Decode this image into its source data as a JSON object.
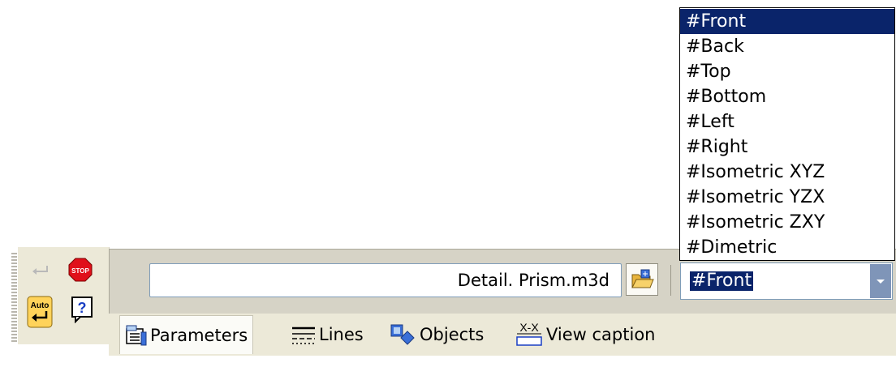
{
  "toolbar": {
    "filename": "Detail. Prism.m3d",
    "view_combo_value": "#Front",
    "buttons": {
      "enter_icon": "enter-arrow-icon",
      "stop_label": "STOP",
      "auto_label": "Auto",
      "help_label": "?"
    }
  },
  "view_dropdown": {
    "items": [
      "#Front",
      "#Back",
      "#Top",
      "#Bottom",
      "#Left",
      "#Right",
      "#Isometric XYZ",
      "#Isometric YZX",
      "#Isometric ZXY",
      "#Dimetric"
    ],
    "selected": "#Front"
  },
  "tabs": {
    "parameters": "Parameters",
    "lines": "Lines",
    "objects": "Objects",
    "view_caption": "View caption",
    "view_caption_icon_text": "X-X"
  },
  "colors": {
    "selection": "#0a246a",
    "panel": "#d6d3c6",
    "toolbar": "#ece9d8",
    "stop_red": "#e0101a",
    "auto_yellow": "#ffd35a"
  }
}
